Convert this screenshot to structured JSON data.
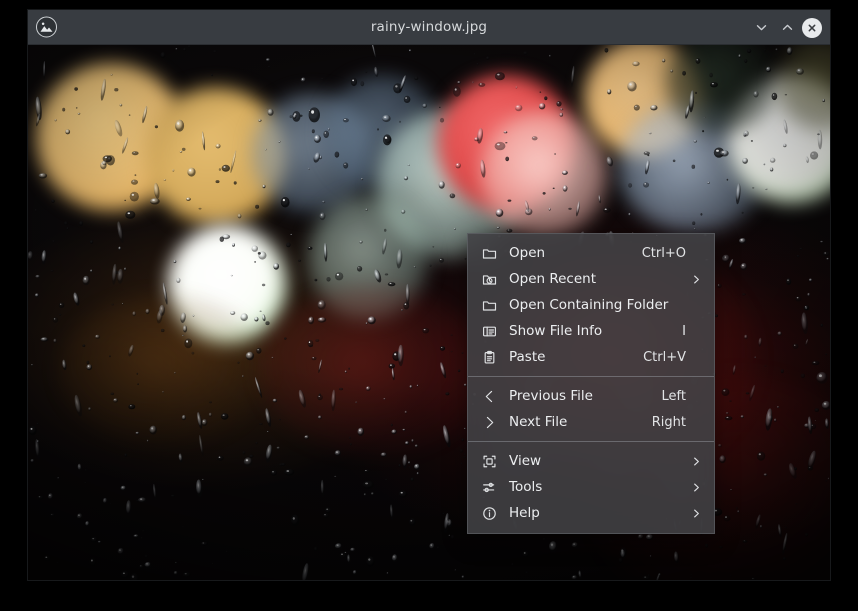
{
  "window": {
    "title": "rainy-window.jpg",
    "app_icon": "image-photo-icon",
    "controls": [
      {
        "name": "minimize-button",
        "icon": "chevron-down-icon"
      },
      {
        "name": "maximize-button",
        "icon": "chevron-up-icon"
      },
      {
        "name": "close-button",
        "icon": "close-icon"
      }
    ]
  },
  "photo": {
    "alt_name": "rainy-window-bokeh-photo",
    "description": "Night bokeh lights seen through a rain-covered window"
  },
  "context_menu": {
    "groups": [
      {
        "items": [
          {
            "icon": "folder-open-icon",
            "label": "Open",
            "shortcut": "Ctrl+O",
            "submenu": false
          },
          {
            "icon": "folder-recent-icon",
            "label": "Open Recent",
            "shortcut": "",
            "submenu": true
          },
          {
            "icon": "folder-icon",
            "label": "Open Containing Folder",
            "shortcut": "",
            "submenu": false
          },
          {
            "icon": "file-info-icon",
            "label": "Show File Info",
            "shortcut": "I",
            "submenu": false
          },
          {
            "icon": "clipboard-paste-icon",
            "label": "Paste",
            "shortcut": "Ctrl+V",
            "submenu": false
          }
        ]
      },
      {
        "items": [
          {
            "icon": "chevron-left-icon",
            "label": "Previous File",
            "shortcut": "Left",
            "submenu": false
          },
          {
            "icon": "chevron-right-icon",
            "label": "Next File",
            "shortcut": "Right",
            "submenu": false
          }
        ]
      },
      {
        "items": [
          {
            "icon": "view-frame-icon",
            "label": "View",
            "shortcut": "",
            "submenu": true
          },
          {
            "icon": "sliders-icon",
            "label": "Tools",
            "shortcut": "",
            "submenu": true
          },
          {
            "icon": "info-circle-icon",
            "label": "Help",
            "shortcut": "",
            "submenu": true
          }
        ]
      }
    ]
  },
  "colors": {
    "titlebar": "#383c41",
    "window_frame": "#2f3337",
    "title_text": "#d6d9db",
    "menu_bg": "rgba(66,66,70,0.88)",
    "menu_text": "#eceef0",
    "menu_separator": "rgba(160,164,170,0.45)",
    "desktop": "#000000"
  }
}
